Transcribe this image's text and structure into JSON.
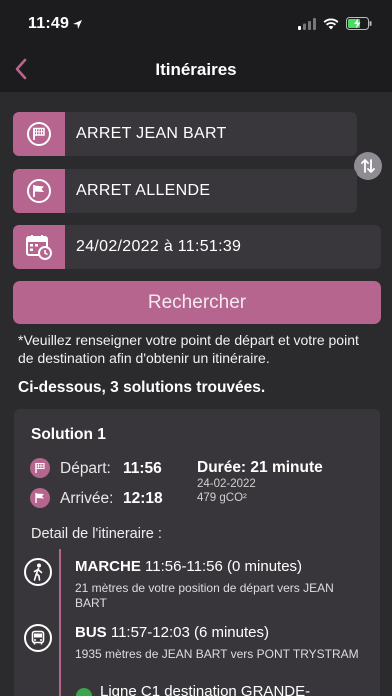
{
  "status_bar": {
    "time": "11:49"
  },
  "nav": {
    "title": "Itinéraires"
  },
  "form": {
    "departure": "ARRET JEAN BART",
    "arrival": "ARRET ALLENDE",
    "datetime": "24/02/2022 à 11:51:39",
    "search_label": "Rechercher"
  },
  "info_note": "*Veuillez renseigner votre point de départ et votre point de destination afin d'obtenir un itinéraire.",
  "results_summary": "Ci-dessous, 3 solutions trouvées.",
  "solution": {
    "title": "Solution 1",
    "depart_label": "Départ:",
    "depart_time": "11:56",
    "arrivee_label": "Arrivée:",
    "arrivee_time": "12:18",
    "duree": "Durée: 21 minute",
    "date": "24-02-2022",
    "co2": "479 gCO²",
    "detail_title": "Detail de l'itineraire :",
    "steps": [
      {
        "mode": "MARCHE",
        "timing": "11:56-11:56 (0 minutes)",
        "description": "21 mètres de votre position de départ vers JEAN BART",
        "icon": "walk-icon"
      },
      {
        "mode": "BUS",
        "timing": "11:57-12:03 (6 minutes)",
        "description": "1935 mètres de JEAN BART vers PONT TRYSTRAM",
        "icon": "bus-icon"
      }
    ],
    "line_text": "Ligne C1 destination  GRANDE-"
  },
  "colors": {
    "accent": "#b6658f",
    "background": "#1c1c1e",
    "panel": "#2b2a2d",
    "card": "#38363a",
    "line_badge": "#3aa64b"
  }
}
